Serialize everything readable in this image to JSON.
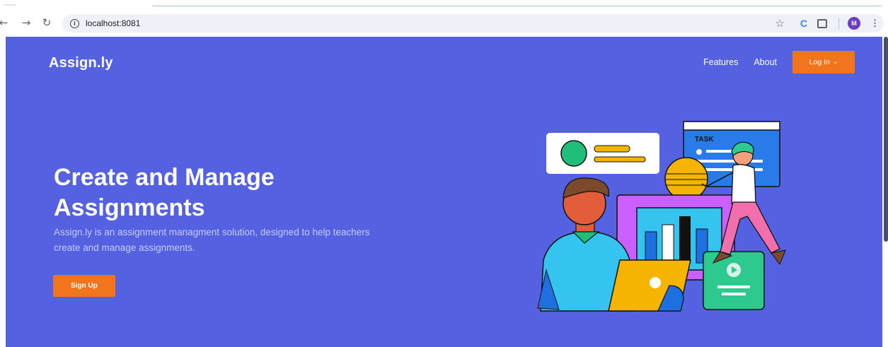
{
  "browser": {
    "url": "localhost:8081",
    "profile_initial": "M",
    "extension_label": "C",
    "icons": [
      "back-icon",
      "forward-icon",
      "reload-icon",
      "info-icon",
      "star-icon",
      "puzzle-icon",
      "kebab-menu-icon"
    ]
  },
  "site": {
    "brand": "Assign.ly",
    "nav": {
      "features": "Features",
      "about": "About",
      "login": "Log In"
    },
    "hero": {
      "title": "Create and Manage Assignments",
      "subtitle": "Assign.ly is an assignment managment solution, designed to help teachers create and manage assignments.",
      "cta": "Sign Up"
    },
    "illustration": {
      "task_label": "TASK"
    }
  },
  "colors": {
    "page_background": "#5461e0",
    "accent_orange": "#f2741c",
    "subtitle_text": "#c9ccf8"
  }
}
